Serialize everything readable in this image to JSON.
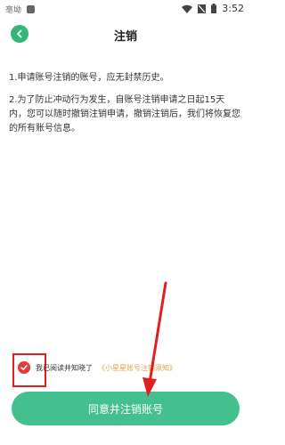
{
  "status_bar": {
    "carrier": "亳坳",
    "time": "3:52"
  },
  "header": {
    "title": "注销"
  },
  "content": {
    "para1": "1.申请账号注销的账号，应无封禁历史。",
    "para2": "2.为了防止冲动行为发生，自账号注销申请之日起15天内，您可以随时撤销注销申请，撤销注销后，我们将恢复您的所有账号信息。"
  },
  "agreement": {
    "text": "我已阅读并知晓了",
    "link": "《小星星账号注销须知》",
    "checked": true
  },
  "submit_label": "同意并注销账号",
  "colors": {
    "accent": "#44c08f",
    "check": "#e23b3b",
    "link": "#e3a24a",
    "annotation": "#e02020"
  }
}
